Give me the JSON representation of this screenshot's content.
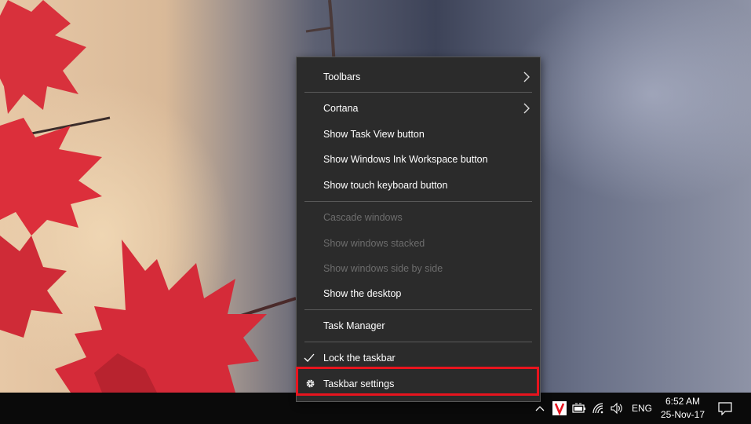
{
  "context_menu": {
    "items": [
      {
        "label": "Toolbars",
        "submenu": true,
        "enabled": true
      },
      {
        "label": "Cortana",
        "submenu": true,
        "enabled": true
      },
      {
        "label": "Show Task View button",
        "enabled": true
      },
      {
        "label": "Show Windows Ink Workspace button",
        "enabled": true
      },
      {
        "label": "Show touch keyboard button",
        "enabled": true
      },
      {
        "label": "Cascade windows",
        "enabled": false
      },
      {
        "label": "Show windows stacked",
        "enabled": false
      },
      {
        "label": "Show windows side by side",
        "enabled": false
      },
      {
        "label": "Show the desktop",
        "enabled": true
      },
      {
        "label": "Task Manager",
        "enabled": true
      },
      {
        "label": "Lock the taskbar",
        "checked": true,
        "enabled": true
      },
      {
        "label": "Taskbar settings",
        "icon": "gear-icon",
        "enabled": true,
        "highlighted": true
      }
    ]
  },
  "taskbar": {
    "tray": {
      "icons": [
        "chevron-up-icon",
        "app-v-icon",
        "battery-icon",
        "wifi-icon",
        "volume-icon"
      ],
      "language": "ENG",
      "time": "6:52 AM",
      "date": "25-Nov-17",
      "notification_icon": "action-center-icon"
    }
  },
  "colors": {
    "menu_bg": "#2b2b2b",
    "menu_text": "#ffffff",
    "menu_disabled": "#6d6d6d",
    "highlight_border": "#e8141e",
    "taskbar_bg": "#0a0a0a"
  }
}
